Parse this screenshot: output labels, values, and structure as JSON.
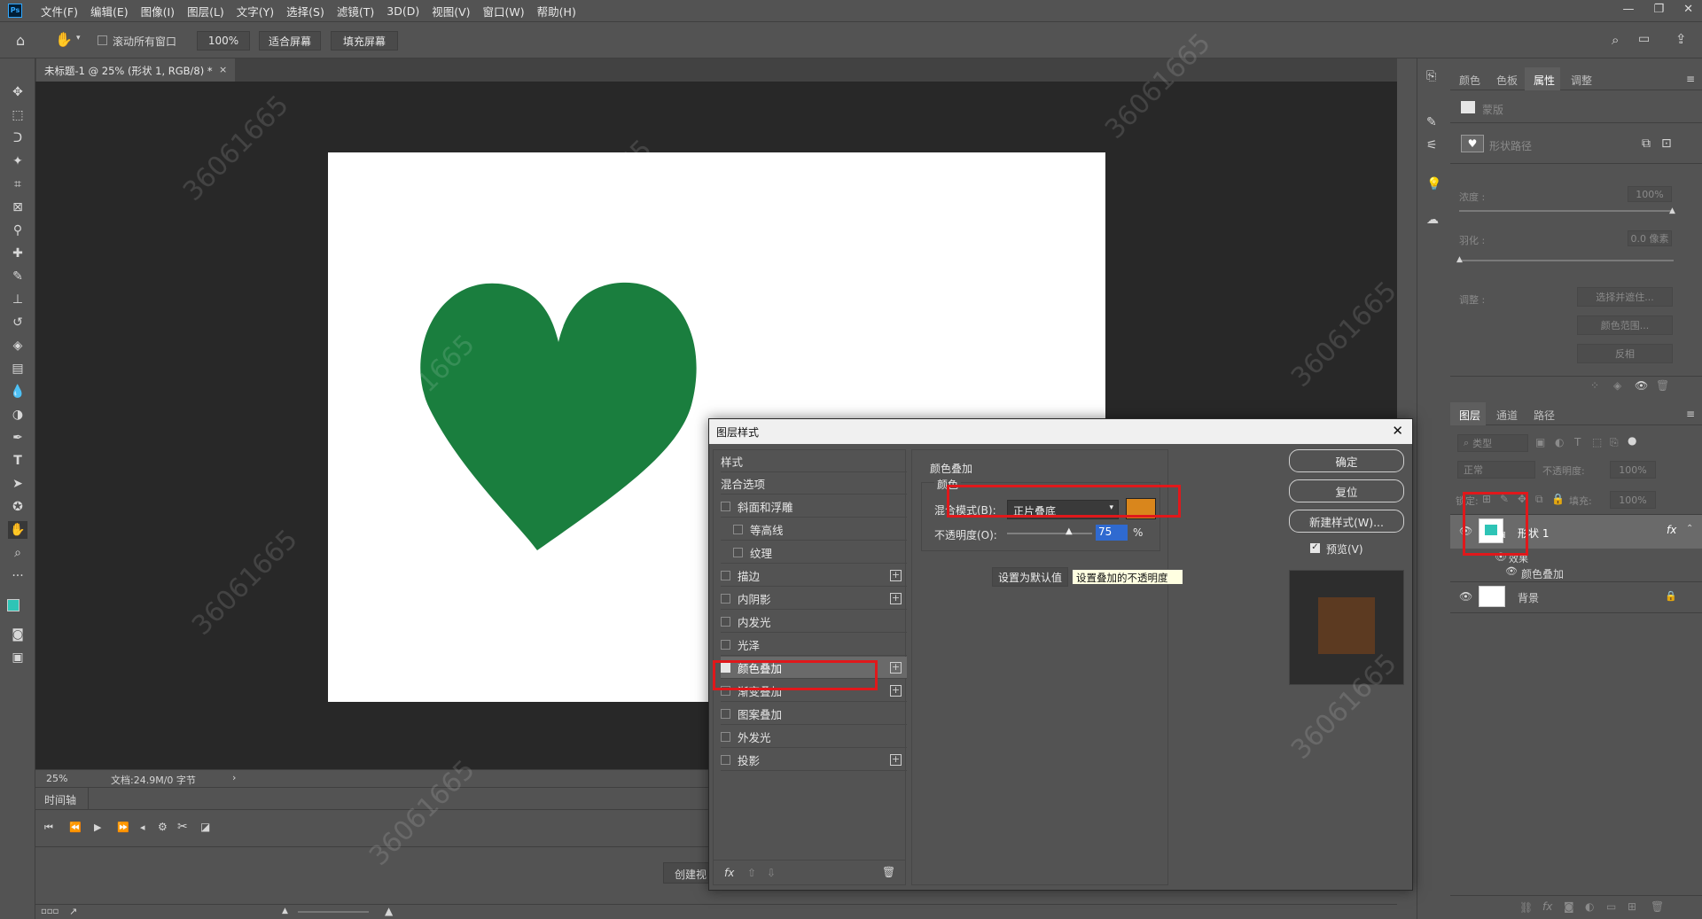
{
  "app": {
    "logo": "Ps"
  },
  "menu": [
    "文件(F)",
    "编辑(E)",
    "图像(I)",
    "图层(L)",
    "文字(Y)",
    "选择(S)",
    "滤镜(T)",
    "3D(D)",
    "视图(V)",
    "窗口(W)",
    "帮助(H)"
  ],
  "options": {
    "scroll_all": "滚动所有窗口",
    "zoom": "100%",
    "fit": "适合屏幕",
    "fill": "填充屏幕"
  },
  "doc": {
    "tab": "未标题-1 @ 25% (形状 1, RGB/8) *",
    "close": "×"
  },
  "status": {
    "zoom": "25%",
    "doc": "文档:24.9M/0 字节",
    "arrow": "›"
  },
  "timeline": {
    "title": "时间轴",
    "create": "创建视"
  },
  "props": {
    "tabs": [
      "颜色",
      "色板",
      "属性",
      "调整"
    ],
    "mask": "蒙版",
    "shape_path": "形状路径",
    "density": "浓度 :",
    "density_val": "100%",
    "feather": "羽化 :",
    "feather_val": "0.0 像素",
    "adjust": "调整 :",
    "btn_select": "选择并遮住...",
    "btn_range": "颜色范围...",
    "btn_invert": "反相"
  },
  "layers": {
    "tabs": [
      "图层",
      "通道",
      "路径"
    ],
    "filter": "类型",
    "mode": "正常",
    "opacity_label": "不透明度:",
    "opacity": "100%",
    "lock_label": "锁定:",
    "fill_label": "填充:",
    "fill": "100%",
    "layer1": "形状 1",
    "effects": "效果",
    "overlay": "颜色叠加",
    "bg": "背景",
    "fx": "fx"
  },
  "dialog": {
    "title": "图层样式",
    "styles": [
      "样式",
      "混合选项",
      "斜面和浮雕",
      "等高线",
      "纹理",
      "描边",
      "内阴影",
      "内发光",
      "光泽",
      "颜色叠加",
      "渐变叠加",
      "图案叠加",
      "外发光",
      "投影"
    ],
    "section": "颜色叠加",
    "subsection": "颜色",
    "blend_label": "混合模式(B):",
    "blend_value": "正片叠底",
    "opacity_label": "不透明度(O):",
    "opacity_value": "75",
    "percent": "%",
    "set_default": "设置为默认值",
    "tooltip": "设置叠加的不透明度",
    "ok": "确定",
    "reset": "复位",
    "new_style": "新建样式(W)...",
    "preview": "预览(V)",
    "fx": "fx"
  },
  "colors": {
    "heart": "#1a7e3e",
    "overlay": "#d9861c",
    "preview": "#5c3a21"
  },
  "watermark": "36061665"
}
